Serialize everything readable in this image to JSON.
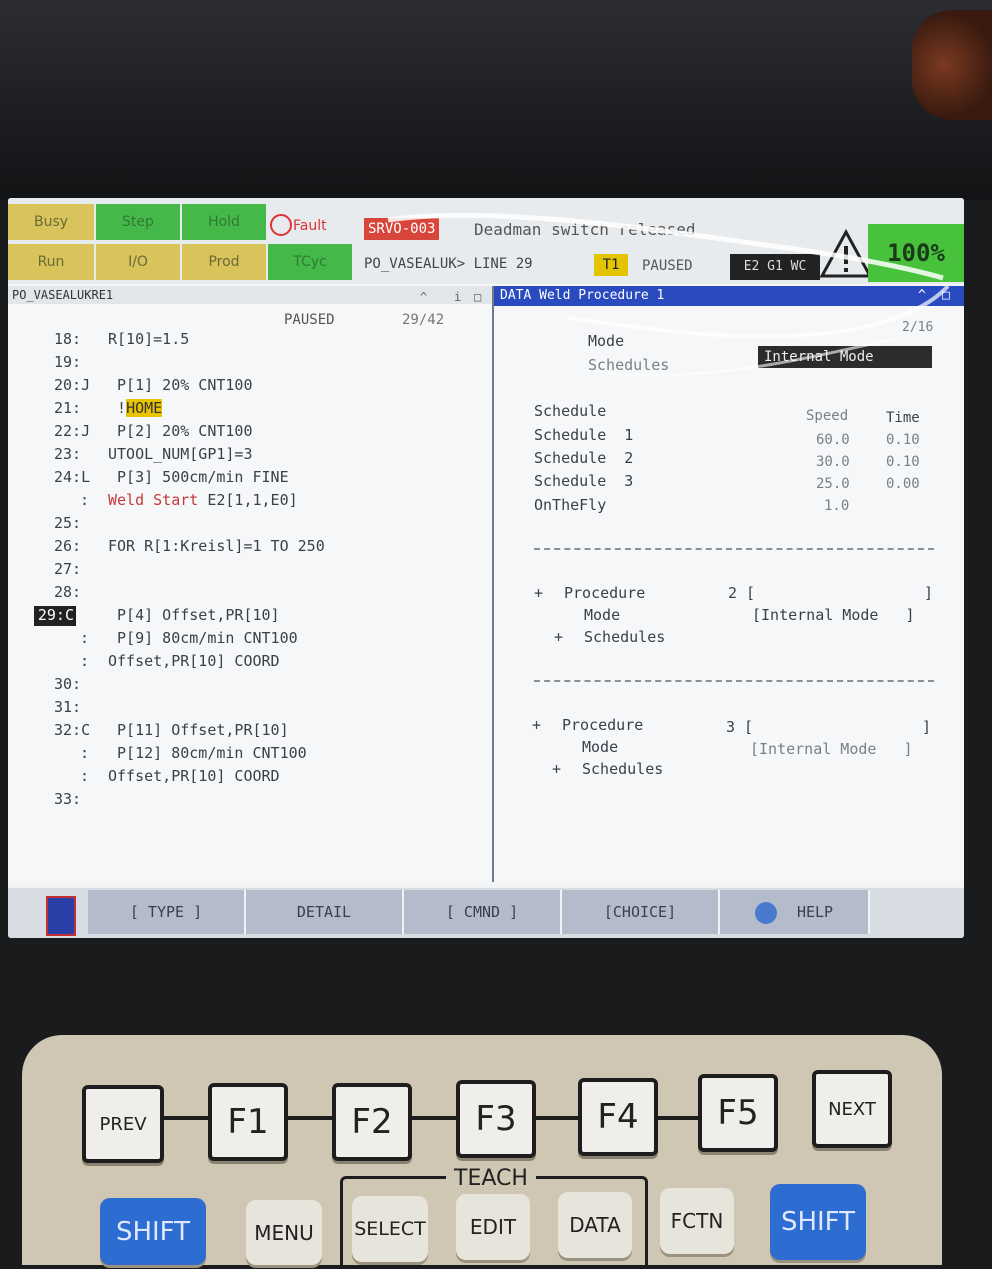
{
  "status": {
    "leds": [
      "Busy",
      "Step",
      "Hold",
      "Fault",
      "Run",
      "I/O",
      "Prod",
      "TCyc"
    ],
    "fault_label": "Fault",
    "alarm_code": "SRVO-003",
    "alarm_message": "Deadman switch released",
    "program_line": "PO_VASEALUK> LINE 29",
    "mode_badge": "T1",
    "state": "PAUSED",
    "group": "E2 G1 WC",
    "override": "100%"
  },
  "program": {
    "name": "PO_VASEALUKRE1",
    "state": "PAUSED",
    "position": "29/42",
    "lines": [
      {
        "num": "18:",
        "code": "R[10]=1.5"
      },
      {
        "num": "19:",
        "code": ""
      },
      {
        "num": "20:J",
        "code": " P[1] 20% CNT100"
      },
      {
        "num": "21:",
        "code": " !HOME"
      },
      {
        "num": "22:J",
        "code": " P[2] 20% CNT100"
      },
      {
        "num": "23:",
        "code": "UTOOL_NUM[GP1]=3"
      },
      {
        "num": "24:L",
        "code": " P[3] 500cm/min FINE"
      },
      {
        "num": ":",
        "code": "Weld Start E2[1,1,E0]"
      },
      {
        "num": "25:",
        "code": ""
      },
      {
        "num": "26:",
        "code": "FOR R[1:Kreisl]=1 TO 250"
      },
      {
        "num": "27:",
        "code": ""
      },
      {
        "num": "28:",
        "code": ""
      },
      {
        "num": "29:C",
        "code": " P[4] Offset,PR[10]"
      },
      {
        "num": ":",
        "code": " P[9] 80cm/min CNT100"
      },
      {
        "num": ":",
        "code": "Offset,PR[10] COORD"
      },
      {
        "num": "30:",
        "code": ""
      },
      {
        "num": "31:",
        "code": ""
      },
      {
        "num": "32:C",
        "code": " P[11] Offset,PR[10]"
      },
      {
        "num": ":",
        "code": " P[12] 80cm/min CNT100"
      },
      {
        "num": ":",
        "code": "Offset,PR[10] COORD"
      },
      {
        "num": "33:",
        "code": ""
      }
    ],
    "home_text": "HOME",
    "weld_word": "Weld Start",
    "weld_rest": " E2[1,1,E0]"
  },
  "data_panel": {
    "title": "DATA Weld Procedure 1",
    "page": "2/16",
    "mode_label": "Mode",
    "mode_value": "Internal Mode",
    "schedules_label": "Schedules",
    "schedule_header": "Schedule",
    "speed_header": "Speed",
    "time_header": "Time",
    "rows": [
      {
        "label": "Schedule  1",
        "speed": "60.0",
        "time": "0.10"
      },
      {
        "label": "Schedule  2",
        "speed": "30.0",
        "time": "0.10"
      },
      {
        "label": "Schedule  3",
        "speed": "25.0",
        "time": "0.00"
      }
    ],
    "onthefly_label": "OnTheFly",
    "onthefly_value": "1.0",
    "procedures": [
      {
        "plus": "+",
        "label": "Procedure",
        "num": "2 [",
        "close": "]",
        "mode_label": "Mode",
        "mode_value": "[Internal Mode   ]",
        "sched_plus": "+",
        "sched_label": "Schedules"
      },
      {
        "plus": "+",
        "label": "Procedure",
        "num": "3 [",
        "close": "]",
        "mode_label": "Mode",
        "mode_value": "[Internal Mode   ]",
        "sched_plus": "+",
        "sched_label": "Schedules"
      }
    ]
  },
  "fkeys": [
    "[ TYPE ]",
    "DETAIL",
    "[ CMND ]",
    "[CHOICE]",
    "HELP"
  ],
  "keypad": {
    "prev": "PREV",
    "next": "NEXT",
    "f": [
      "F1",
      "F2",
      "F3",
      "F4",
      "F5"
    ],
    "teach": "TEACH",
    "bottom": [
      "SHIFT",
      "MENU",
      "SELECT",
      "EDIT",
      "DATA",
      "FCTN",
      "SHIFT"
    ]
  },
  "colors": {
    "alarm": "#d8453a",
    "override": "#48c23c",
    "data_header": "#2a4ac0",
    "tp_badge": "#e2c400"
  }
}
